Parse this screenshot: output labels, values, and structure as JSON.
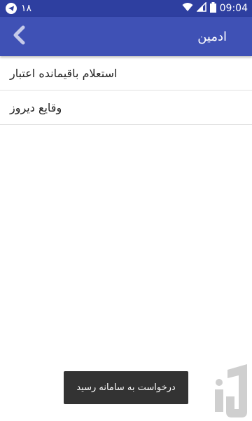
{
  "status_bar": {
    "time": "09:04",
    "notification_count": "۱۸",
    "icons": [
      "telegram-icon",
      "wifi-icon",
      "signal-icon",
      "battery-icon"
    ]
  },
  "app_bar": {
    "title": "ادمین",
    "back_icon": "chevron-left-icon"
  },
  "menu": {
    "items": [
      {
        "label": "استعلام باقیمانده اعتبار"
      },
      {
        "label": "وقایع دیروز"
      }
    ]
  },
  "toast": {
    "message": "درخواست به سامانه رسید"
  },
  "colors": {
    "status_bar": "#2e3fa0",
    "app_bar": "#3f51b5",
    "toast": "#333333",
    "logo": "#cfcfcf"
  }
}
